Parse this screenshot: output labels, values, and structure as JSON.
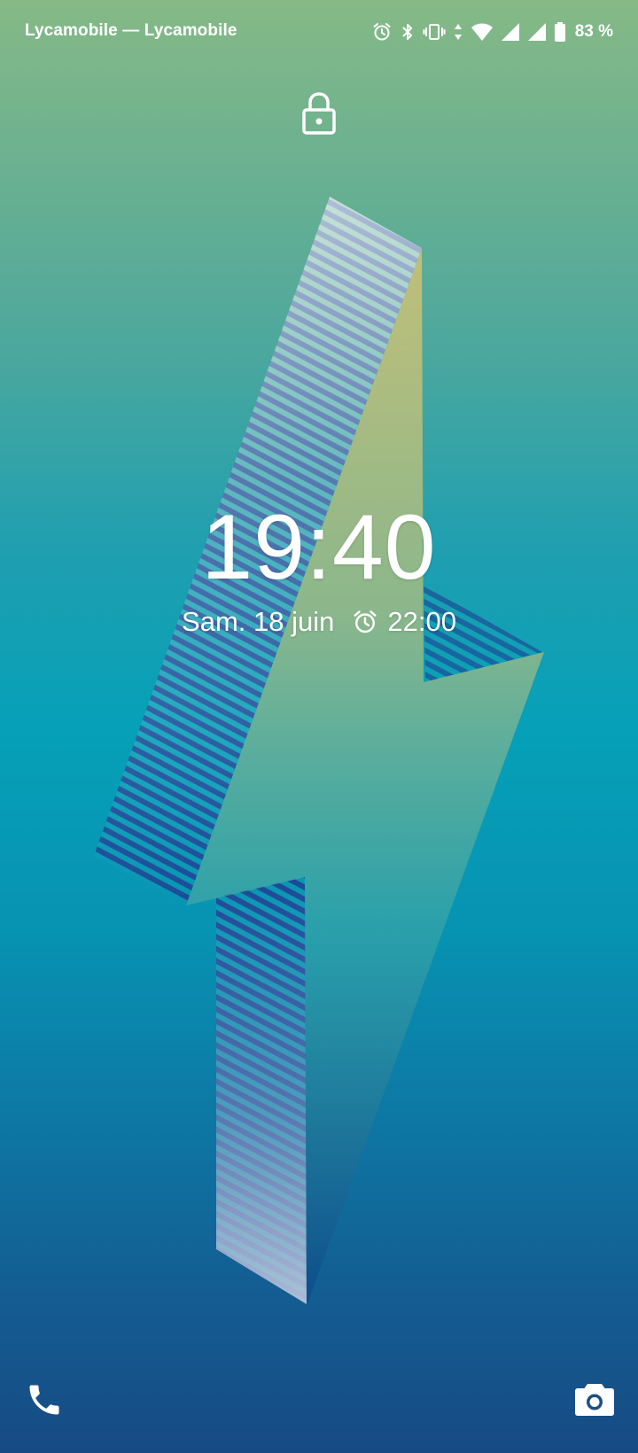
{
  "status_bar": {
    "carrier": "Lycamobile — Lycamobile",
    "battery_percent": "83 %",
    "icons": [
      "alarm-icon",
      "bluetooth-icon",
      "vibrate-icon",
      "data-arrows-icon",
      "wifi-icon",
      "signal-icon",
      "signal-icon",
      "battery-icon"
    ],
    "battery_level": 0.83
  },
  "lockscreen": {
    "time": "19:40",
    "date": "Sam. 18 juin",
    "alarm_time": "22:00",
    "lock_icon": "lock-icon"
  },
  "shortcuts": {
    "left": "phone-icon",
    "right": "camera-icon"
  },
  "colors": {
    "top": "#86b986",
    "middle": "#06a0b8",
    "bottom": "#174a84",
    "bolt": "#b7c07f",
    "stripes": "#1d3f93"
  }
}
